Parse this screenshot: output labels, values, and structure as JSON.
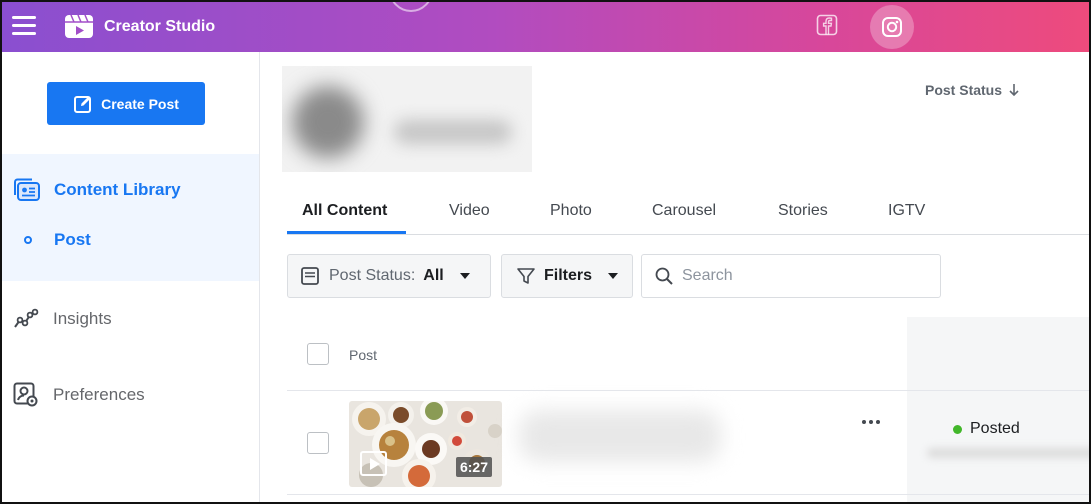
{
  "header": {
    "title": "Creator Studio",
    "menu_icon": "hamburger-menu-icon",
    "logo_icon": "clapperboard-icon",
    "platforms": [
      {
        "name": "facebook",
        "icon": "facebook-icon"
      },
      {
        "name": "instagram",
        "icon": "instagram-icon",
        "active": true
      }
    ],
    "colors": {
      "gradient_start": "#8a4fd0",
      "gradient_end": "#ee4b7c"
    }
  },
  "sidebar": {
    "create_label": "Create Post",
    "items": [
      {
        "label": "Content Library",
        "icon": "content-library-icon",
        "active": true
      },
      {
        "label": "Post",
        "icon": "dot-icon",
        "active": true
      },
      {
        "label": "Insights",
        "icon": "insights-icon"
      },
      {
        "label": "Preferences",
        "icon": "preferences-icon"
      }
    ],
    "accent": "#1877f2"
  },
  "tabs": [
    {
      "label": "All Content",
      "active": true
    },
    {
      "label": "Video"
    },
    {
      "label": "Photo"
    },
    {
      "label": "Carousel"
    },
    {
      "label": "Stories"
    },
    {
      "label": "IGTV"
    }
  ],
  "filters": {
    "status_label": "Post Status:",
    "status_value": "All",
    "filters_label": "Filters",
    "search_placeholder": "Search"
  },
  "table": {
    "columns": {
      "post": "Post",
      "status": "Post Status"
    },
    "rows": [
      {
        "duration": "6:27",
        "status": "Posted",
        "status_color": "#42b72a"
      }
    ]
  }
}
